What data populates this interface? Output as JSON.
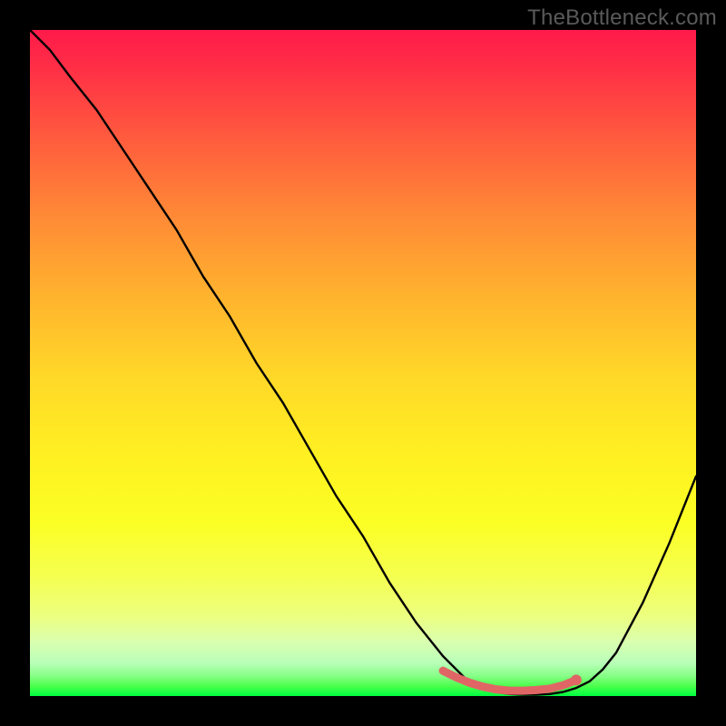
{
  "watermark": "TheBottleneck.com",
  "colors": {
    "background": "#000000",
    "curve": "#000000",
    "sweet_spot": "#e06666",
    "gradient_top": "#ff1a4a",
    "gradient_bottom": "#00ff40"
  },
  "chart_data": {
    "type": "line",
    "title": "",
    "xlabel": "",
    "ylabel": "",
    "xlim": [
      0,
      100
    ],
    "ylim": [
      0,
      100
    ],
    "grid": false,
    "legend": false,
    "series": [
      {
        "name": "bottleneck_curve",
        "x": [
          0,
          3,
          6,
          10,
          14,
          18,
          22,
          26,
          30,
          34,
          38,
          42,
          46,
          50,
          54,
          58,
          62,
          64,
          66,
          68,
          70,
          72,
          74,
          76,
          78,
          80,
          82,
          84,
          86,
          88,
          92,
          96,
          100
        ],
        "y": [
          100,
          97,
          93,
          88,
          82,
          76,
          70,
          63,
          57,
          50,
          44,
          37,
          30,
          24,
          17,
          11,
          6,
          4,
          2,
          1.2,
          0.6,
          0.3,
          0.2,
          0.2,
          0.3,
          0.6,
          1.2,
          2.2,
          4,
          6.5,
          14,
          23,
          33
        ]
      }
    ],
    "sweet_spot": {
      "x": [
        62,
        64,
        66,
        68,
        70,
        72,
        74,
        76,
        78,
        80,
        82
      ],
      "y": [
        3.8,
        2.8,
        2.0,
        1.4,
        1.0,
        0.8,
        0.8,
        0.9,
        1.1,
        1.6,
        2.4
      ],
      "end_dot": {
        "x": 82,
        "y": 2.4
      }
    }
  }
}
